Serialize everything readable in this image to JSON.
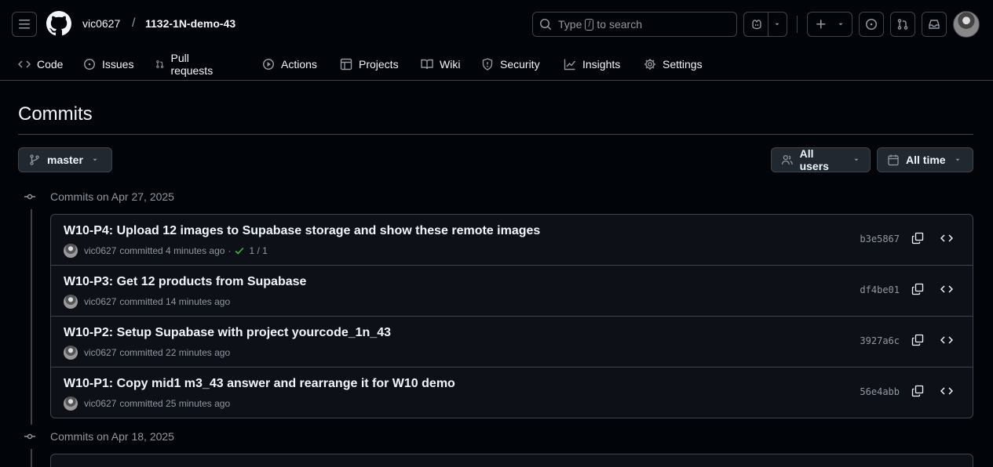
{
  "header": {
    "owner": "vic0627",
    "separator": "/",
    "repo": "1132-1N-demo-43",
    "search": {
      "prefix": "Type",
      "key": "/",
      "suffix": "to search"
    }
  },
  "nav": {
    "items": [
      {
        "label": "Code",
        "icon": "code-icon"
      },
      {
        "label": "Issues",
        "icon": "issue-icon"
      },
      {
        "label": "Pull requests",
        "icon": "pull-request-icon"
      },
      {
        "label": "Actions",
        "icon": "play-icon"
      },
      {
        "label": "Projects",
        "icon": "table-icon"
      },
      {
        "label": "Wiki",
        "icon": "book-icon"
      },
      {
        "label": "Security",
        "icon": "shield-icon"
      },
      {
        "label": "Insights",
        "icon": "graph-icon"
      },
      {
        "label": "Settings",
        "icon": "gear-icon"
      }
    ]
  },
  "page": {
    "title": "Commits",
    "branch": "master",
    "users_filter": "All users",
    "time_filter": "All time"
  },
  "groups": [
    {
      "heading": "Commits on Apr 27, 2025",
      "commits": [
        {
          "title": "W10-P4: Upload 12 images to Supabase storage and show these remote images",
          "author": "vic0627",
          "committed": "committed 4 minutes ago",
          "dot": "·",
          "checks": "1 / 1",
          "sha": "b3e5867"
        },
        {
          "title": "W10-P3: Get 12 products from Supabase",
          "author": "vic0627",
          "committed": "committed 14 minutes ago",
          "sha": "df4be01"
        },
        {
          "title": "W10-P2: Setup Supabase with project yourcode_1n_43",
          "author": "vic0627",
          "committed": "committed 22 minutes ago",
          "sha": "3927a6c"
        },
        {
          "title": "W10-P1: Copy mid1 m3_43 answer and rearrange it for W10 demo",
          "author": "vic0627",
          "committed": "committed 25 minutes ago",
          "sha": "56e4abb"
        }
      ]
    },
    {
      "heading": "Commits on Apr 18, 2025",
      "commits": []
    }
  ],
  "colors": {
    "background": "#010409",
    "border": "#3d444d",
    "muted": "#9198a1",
    "success": "#3fb950"
  }
}
